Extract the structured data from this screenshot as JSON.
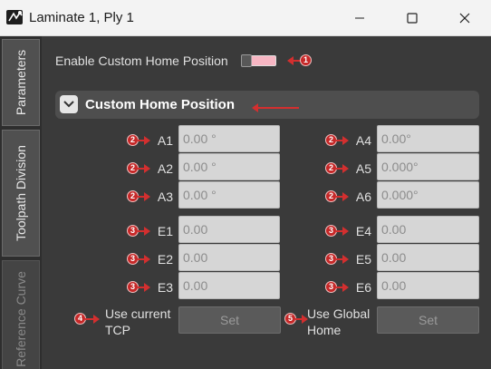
{
  "window": {
    "title": "Laminate 1, Ply 1",
    "icon": "laminate-app-icon",
    "buttons": [
      "minimize-icon",
      "maximize-icon",
      "close-icon"
    ]
  },
  "tabs": [
    {
      "label": "Parameters",
      "active": true
    },
    {
      "label": "Toolpath Division",
      "active": true
    },
    {
      "label": "Reference Curve",
      "active": false
    }
  ],
  "enable": {
    "label": "Enable Custom Home Position"
  },
  "section": {
    "title": "Custom Home Position",
    "icon": "chevron-down-icon"
  },
  "axes_left": [
    {
      "label": "A1",
      "value": "0.00 °",
      "badge": "2"
    },
    {
      "label": "A2",
      "value": "0.00 °",
      "badge": "2"
    },
    {
      "label": "A3",
      "value": "0.00 °",
      "badge": "2"
    }
  ],
  "axes_right": [
    {
      "label": "A4",
      "value": "0.00°",
      "badge": "2"
    },
    {
      "label": "A5",
      "value": "0.000°",
      "badge": "2"
    },
    {
      "label": "A6",
      "value": "0.000°",
      "badge": "2"
    }
  ],
  "ext_left": [
    {
      "label": "E1",
      "value": "0.00",
      "badge": "3"
    },
    {
      "label": "E2",
      "value": "0.00",
      "badge": "3"
    },
    {
      "label": "E3",
      "value": "0.00",
      "badge": "3"
    }
  ],
  "ext_right": [
    {
      "label": "E4",
      "value": "0.00",
      "badge": "3"
    },
    {
      "label": "E5",
      "value": "0.00",
      "badge": "3"
    },
    {
      "label": "E6",
      "value": "0.00",
      "badge": "3"
    }
  ],
  "use_tcp": {
    "line1": "Use current",
    "line2": "TCP",
    "button": "Set",
    "badge": "4"
  },
  "use_home": {
    "line1": "Use Global",
    "line2": "Home",
    "button": "Set",
    "badge": "5"
  },
  "callouts": {
    "enable_badge": "1"
  },
  "colors": {
    "callout": "#c62828",
    "toggle_on": "#f7b6c3",
    "background": "#3a3a3a"
  }
}
